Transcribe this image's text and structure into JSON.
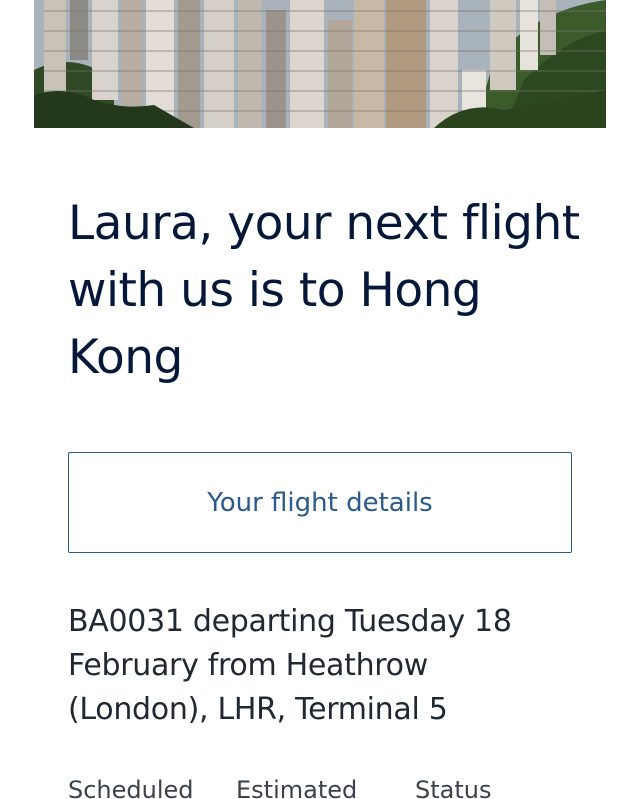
{
  "hero": {
    "image_description": "Hong Kong skyline"
  },
  "headline": "Laura, your next flight with us is to Hong Kong",
  "details_button": {
    "label": "Your flight details"
  },
  "flight_info": "BA0031 departing Tuesday 18 February from Heathrow (London), LHR, Terminal 5",
  "status_columns": {
    "scheduled": "Scheduled",
    "estimated": "Estimated",
    "status": "Status"
  },
  "colors": {
    "headline": "#06183a",
    "button_border": "#2b5a8c",
    "button_text": "#2b5a8c",
    "body_text": "#202833"
  }
}
